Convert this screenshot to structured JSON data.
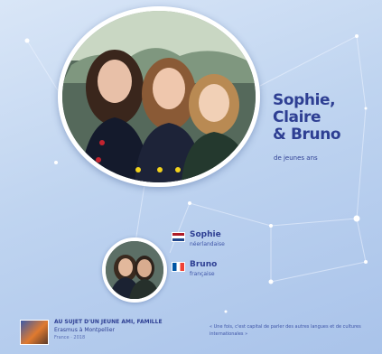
{
  "poster": {
    "names_line1": "Sophie,",
    "names_line2": "Claire",
    "names_line3": "& Bruno",
    "names_subtitle": "de jeunes ans"
  },
  "people": [
    {
      "name": "Sophie",
      "nationality": "néerlandaise",
      "flag": "netherlands-flag"
    },
    {
      "name": "Bruno",
      "nationality": "française",
      "flag": "france-flag"
    }
  ],
  "footer": {
    "title": "Au sujet d'un jeune ami, famille",
    "subtitle": "Erasmus à Montpellier",
    "meta": "France · 2018",
    "quote": "« Une fois, c'est capital de parler des autres langues et de cultures internationales »"
  },
  "colors": {
    "accent": "#2e3f93",
    "background": "#bfd4f0",
    "photo_border": "#ffffff"
  }
}
